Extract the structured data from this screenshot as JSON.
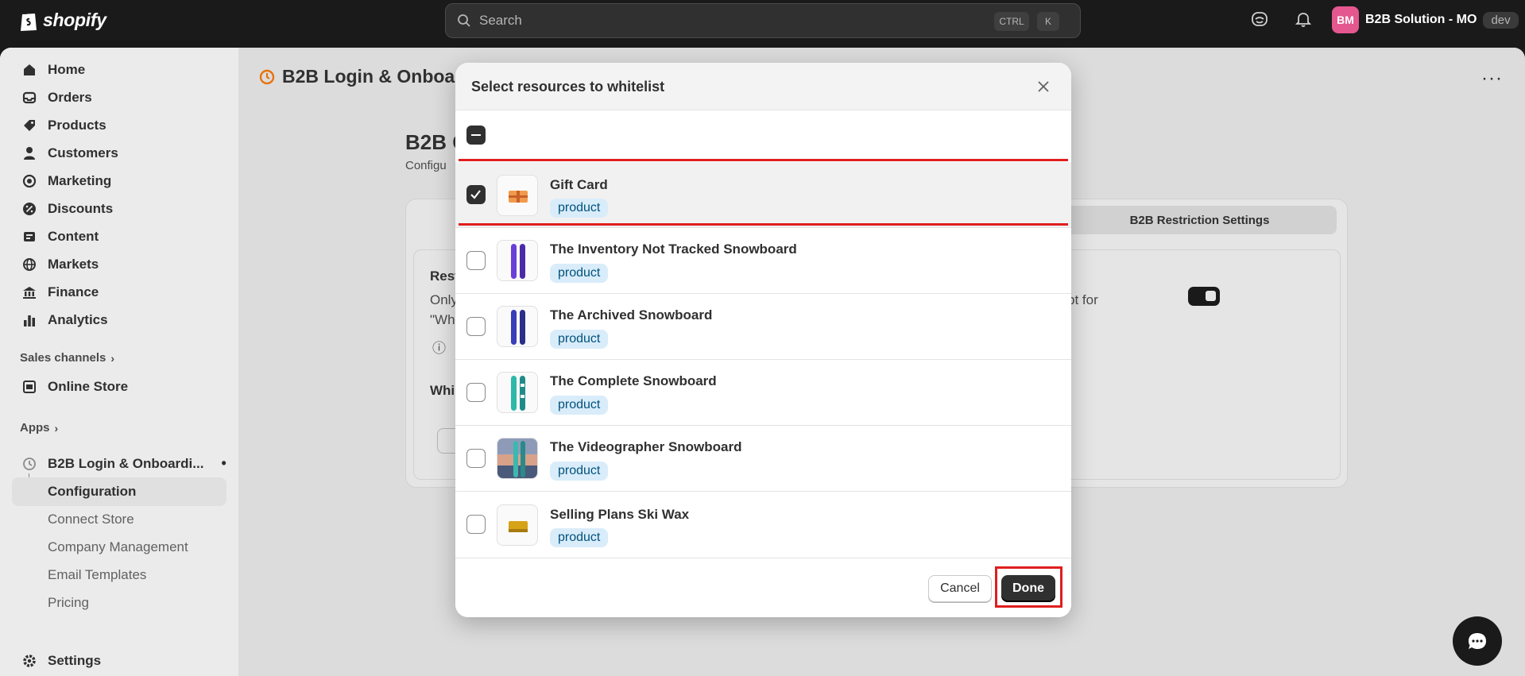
{
  "topbar": {
    "brand": "shopify",
    "search_placeholder": "Search",
    "kbd_ctrl": "CTRL",
    "kbd_k": "K",
    "account_initials": "BM",
    "store_name": "B2B Solution - MO",
    "store_badge": "dev"
  },
  "sidebar": {
    "items": [
      {
        "label": "Home",
        "icon": "home-icon"
      },
      {
        "label": "Orders",
        "icon": "inbox-icon"
      },
      {
        "label": "Products",
        "icon": "tag-icon"
      },
      {
        "label": "Customers",
        "icon": "person-icon"
      },
      {
        "label": "Marketing",
        "icon": "target-icon"
      },
      {
        "label": "Discounts",
        "icon": "discount-icon"
      },
      {
        "label": "Content",
        "icon": "content-icon"
      },
      {
        "label": "Markets",
        "icon": "globe-icon"
      },
      {
        "label": "Finance",
        "icon": "bank-icon"
      },
      {
        "label": "Analytics",
        "icon": "chart-icon"
      }
    ],
    "sales_channels_label": "Sales channels",
    "online_store_label": "Online Store",
    "apps_label": "Apps",
    "app_name": "B2B Login & Onboardi...",
    "app_subitems": [
      "Configuration",
      "Connect Store",
      "Company Management",
      "Email Templates",
      "Pricing"
    ],
    "settings_label": "Settings"
  },
  "page": {
    "title": "B2B Login & Onboard",
    "heading": "B2B C",
    "subheading": "Configu",
    "tab_label": "B2B Restriction Settings",
    "text_rest": "Rest",
    "text_only": "Only",
    "text_wh": "\"Wh",
    "text_pt_for": "pt for",
    "text_whi": "Whi"
  },
  "modal": {
    "title": "Select resources to whitelist",
    "items": [
      {
        "name": "Gift Card",
        "type": "product",
        "checked": true
      },
      {
        "name": "The Inventory Not Tracked Snowboard",
        "type": "product",
        "checked": false
      },
      {
        "name": "The Archived Snowboard",
        "type": "product",
        "checked": false
      },
      {
        "name": "The Complete Snowboard",
        "type": "product",
        "checked": false
      },
      {
        "name": "The Videographer Snowboard",
        "type": "product",
        "checked": false
      },
      {
        "name": "Selling Plans Ski Wax",
        "type": "product",
        "checked": false
      }
    ],
    "cancel_label": "Cancel",
    "done_label": "Done"
  },
  "colors": {
    "topbar": "#1a1a1a",
    "accent_dark": "#303030",
    "badge_bg": "#d9ecfa",
    "highlight_red": "#e01e1e",
    "avatar": "#e4578f"
  }
}
